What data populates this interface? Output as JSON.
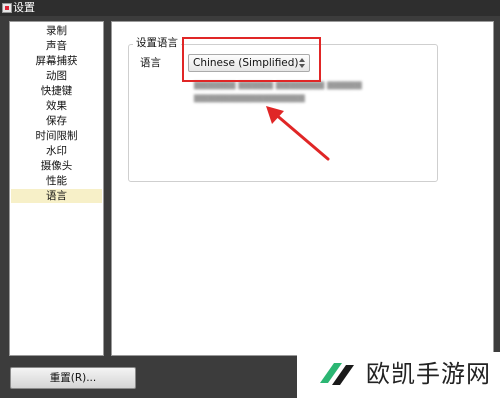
{
  "window": {
    "title": "设置"
  },
  "sidebar": {
    "items": [
      {
        "label": "录制",
        "selected": false
      },
      {
        "label": "声音",
        "selected": false
      },
      {
        "label": "屏幕捕获",
        "selected": false
      },
      {
        "label": "动图",
        "selected": false
      },
      {
        "label": "快捷键",
        "selected": false
      },
      {
        "label": "效果",
        "selected": false
      },
      {
        "label": "保存",
        "selected": false
      },
      {
        "label": "时间限制",
        "selected": false
      },
      {
        "label": "水印",
        "selected": false
      },
      {
        "label": "摄像头",
        "selected": false
      },
      {
        "label": "性能",
        "selected": false
      },
      {
        "label": "语言",
        "selected": true
      }
    ]
  },
  "language_group": {
    "title": "设置语言",
    "label": "语言",
    "selected_value": "Chinese (Simplified)"
  },
  "footer": {
    "reset_label": "重置(R)..."
  },
  "watermark": {
    "text": "欧凯手游网"
  },
  "colors": {
    "highlight": "#e02626",
    "selected_item": "#f7f0c8",
    "logo_green": "#2bb673"
  }
}
